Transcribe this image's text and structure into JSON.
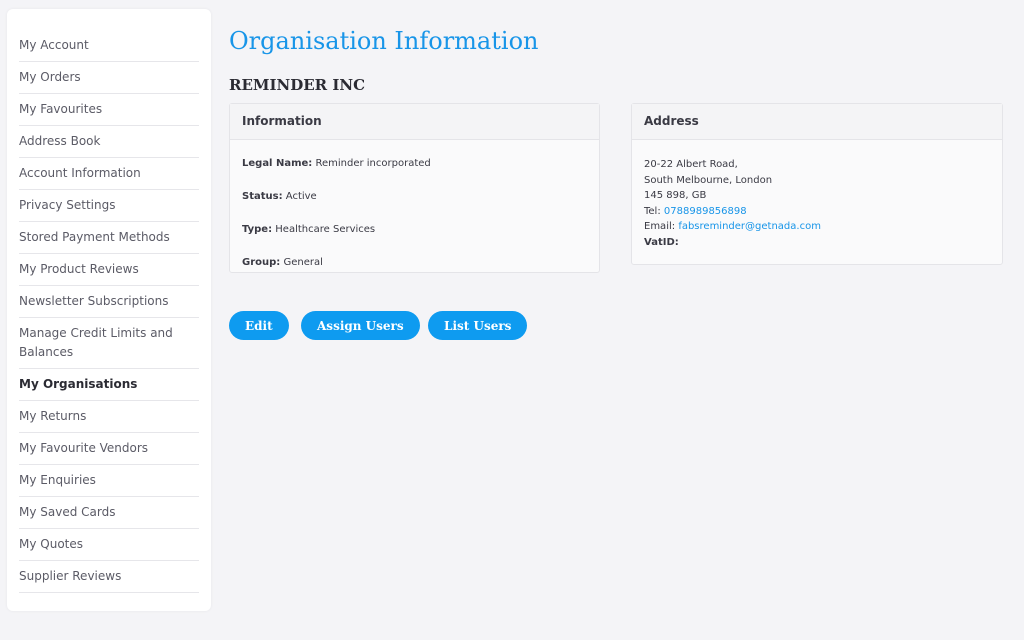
{
  "sidebar": {
    "items": [
      {
        "label": "My Account"
      },
      {
        "label": "My Orders"
      },
      {
        "label": "My Favourites"
      },
      {
        "label": "Address Book"
      },
      {
        "label": "Account Information"
      },
      {
        "label": "Privacy Settings"
      },
      {
        "label": "Stored Payment Methods"
      },
      {
        "label": "My Product Reviews"
      },
      {
        "label": "Newsletter Subscriptions"
      },
      {
        "label": "Manage Credit Limits and Balances"
      },
      {
        "label": "My Organisations"
      },
      {
        "label": "My Returns"
      },
      {
        "label": "My Favourite Vendors"
      },
      {
        "label": "My Enquiries"
      },
      {
        "label": "My Saved Cards"
      },
      {
        "label": "My Quotes"
      },
      {
        "label": "Supplier Reviews"
      }
    ],
    "active_label": "My Organisations"
  },
  "page": {
    "title": "Organisation Information",
    "org_name": "REMINDER INC"
  },
  "information": {
    "header": "Information",
    "legal_name_label": "Legal Name:",
    "legal_name": "Reminder incorporated",
    "status_label": "Status:",
    "status": "Active",
    "type_label": "Type:",
    "type": "Healthcare Services",
    "group_label": "Group:",
    "group": "General"
  },
  "address": {
    "header": "Address",
    "line1": "20-22 Albert Road,",
    "line2": "South Melbourne, London",
    "line3": "145 898, GB",
    "tel_label": "Tel:",
    "tel": "0788989856898",
    "email_label": "Email:",
    "email": "fabsreminder@getnada.com",
    "vat_label": "VatID:"
  },
  "actions": {
    "edit_label": "Edit",
    "assign_users_label": "Assign Users",
    "list_users_label": "List Users"
  },
  "colors": {
    "accent": "#1895e8",
    "button": "#0e9bf0",
    "background": "#f4f4f7"
  }
}
